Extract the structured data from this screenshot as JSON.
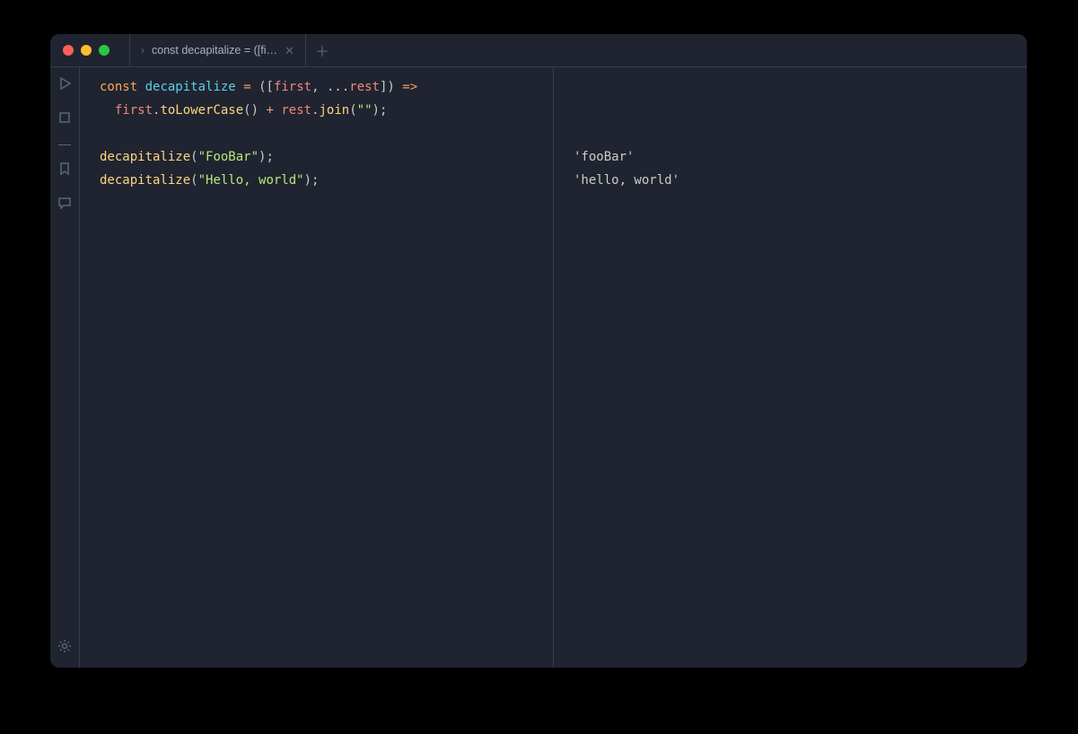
{
  "tab": {
    "title": "const decapitalize = ([fi…"
  },
  "code": {
    "line1": {
      "kw": "const",
      "name": "decapitalize",
      "eq": "=",
      "op1": "(",
      "op2": "[",
      "p1": "first",
      "comma": ",",
      "spread": "...",
      "p2": "rest",
      "op3": "]",
      "op4": ")",
      "arrow": "=>"
    },
    "line2": {
      "indent": "  ",
      "p1": "first",
      "dot1": ".",
      "m1": "toLowerCase",
      "call1": "()",
      "plus": "+",
      "p2": "rest",
      "dot2": ".",
      "m2": "join",
      "open": "(",
      "str": "\"\"",
      "close": ")",
      "semi": ";"
    },
    "line4": {
      "fn": "decapitalize",
      "open": "(",
      "str": "\"FooBar\"",
      "close": ")",
      "semi": ";"
    },
    "line5": {
      "fn": "decapitalize",
      "open": "(",
      "str": "\"Hello, world\"",
      "close": ")",
      "semi": ";"
    }
  },
  "output": {
    "r1": "'fooBar'",
    "r2": "'hello, world'"
  }
}
